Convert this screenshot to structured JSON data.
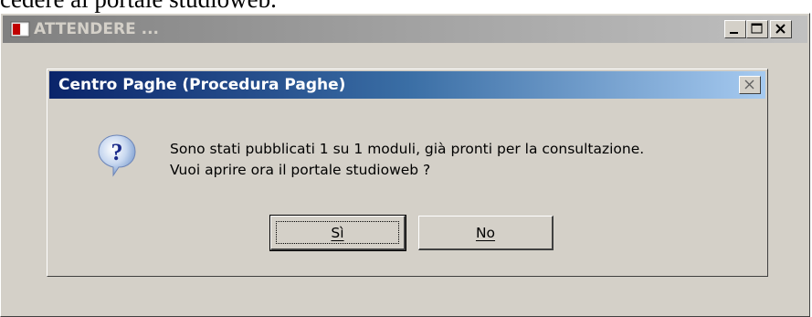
{
  "page_text": "cedere al portale studioweb.",
  "outer_window": {
    "title": "ATTENDERE ..."
  },
  "dialog": {
    "title": "Centro Paghe (Procedura Paghe)",
    "message_line1": "Sono stati pubblicati  1 su 1 moduli, già pronti per la consultazione.",
    "message_line2": "Vuoi aprire ora il portale studioweb ?",
    "yes_label": "Sì",
    "no_label": "No"
  },
  "colors": {
    "dialog_title_start": "#0a246a",
    "dialog_title_end": "#a6caf0",
    "face": "#d4d0c8"
  },
  "icons": {
    "app": "app-icon",
    "question": "question-icon",
    "minimize": "minimize-icon",
    "maximize": "maximize-icon",
    "close": "close-icon"
  }
}
